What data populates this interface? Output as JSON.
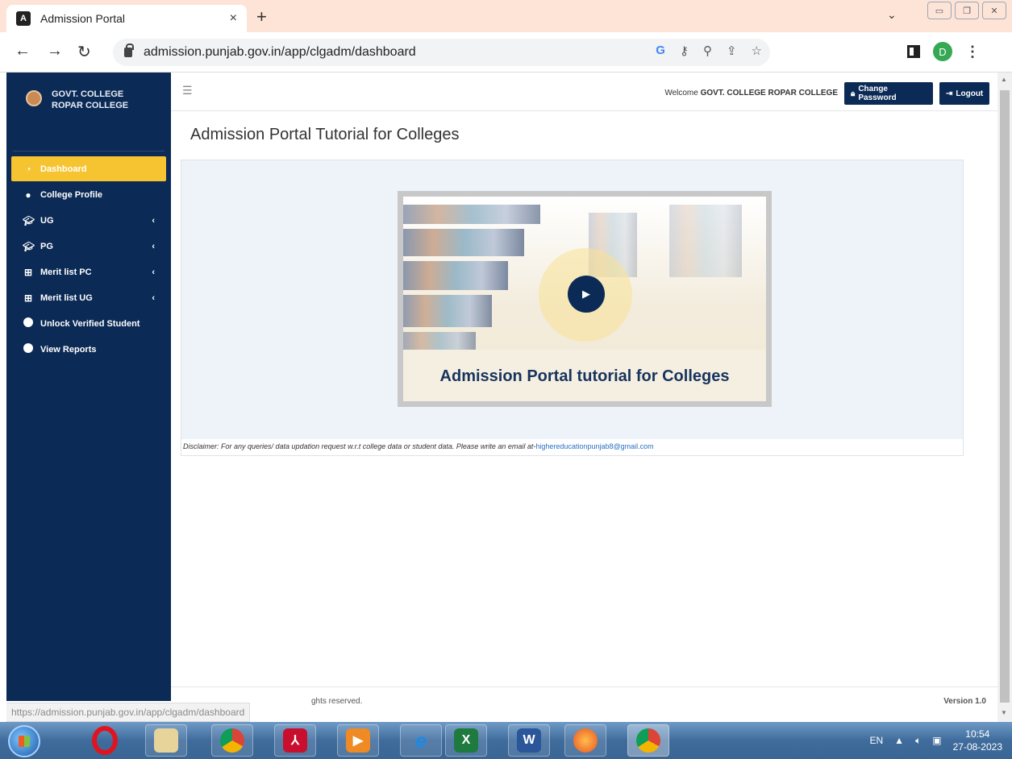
{
  "browser": {
    "tab_title": "Admission Portal",
    "tab_close": "×",
    "new_tab": "+",
    "url": "admission.punjab.gov.in/app/clgadm/dashboard",
    "status_url": "https://admission.punjab.gov.in/app/clgadm/dashboard",
    "profile_initial": "D"
  },
  "sidebar": {
    "college_name": "GOVT. COLLEGE ROPAR COLLEGE",
    "items": [
      {
        "label": "Dashboard",
        "icon": "dashboard-icon",
        "active": true,
        "caret": ""
      },
      {
        "label": "College Profile",
        "icon": "user-icon",
        "caret": ""
      },
      {
        "label": "UG",
        "icon": "graduation-cap-icon",
        "caret": "‹"
      },
      {
        "label": "PG",
        "icon": "graduation-cap-icon",
        "caret": "‹"
      },
      {
        "label": "Merit list PC",
        "icon": "sitemap-icon",
        "caret": "‹"
      },
      {
        "label": "Merit list UG",
        "icon": "sitemap-icon",
        "caret": "‹"
      },
      {
        "label": "Unlock Verified Student",
        "icon": "circle-icon",
        "caret": ""
      },
      {
        "label": "View Reports",
        "icon": "circle-icon",
        "caret": ""
      }
    ]
  },
  "topnav": {
    "welcome_prefix": "Welcome",
    "welcome_name": "GOVT. COLLEGE ROPAR COLLEGE",
    "change_password": "Change Password",
    "logout": "Logout"
  },
  "main": {
    "page_title": "Admission Portal Tutorial for Colleges",
    "video_caption": "Admission Portal tutorial for Colleges",
    "disclaimer": "Disclaimer: For any queries/ data updation request w.r.t college data or student data. Please write an email at-",
    "disclaimer_email": "highereducationpunjab8@gmail.com"
  },
  "footer": {
    "rights": "ghts reserved.",
    "version": "Version 1.0"
  },
  "taskbar": {
    "lang": "EN",
    "time": "10:54",
    "date": "27-08-2023"
  },
  "colors": {
    "sidebar_bg": "#0b2a55",
    "active_item": "#f7c431",
    "tabbar_bg": "#fde4d6"
  }
}
